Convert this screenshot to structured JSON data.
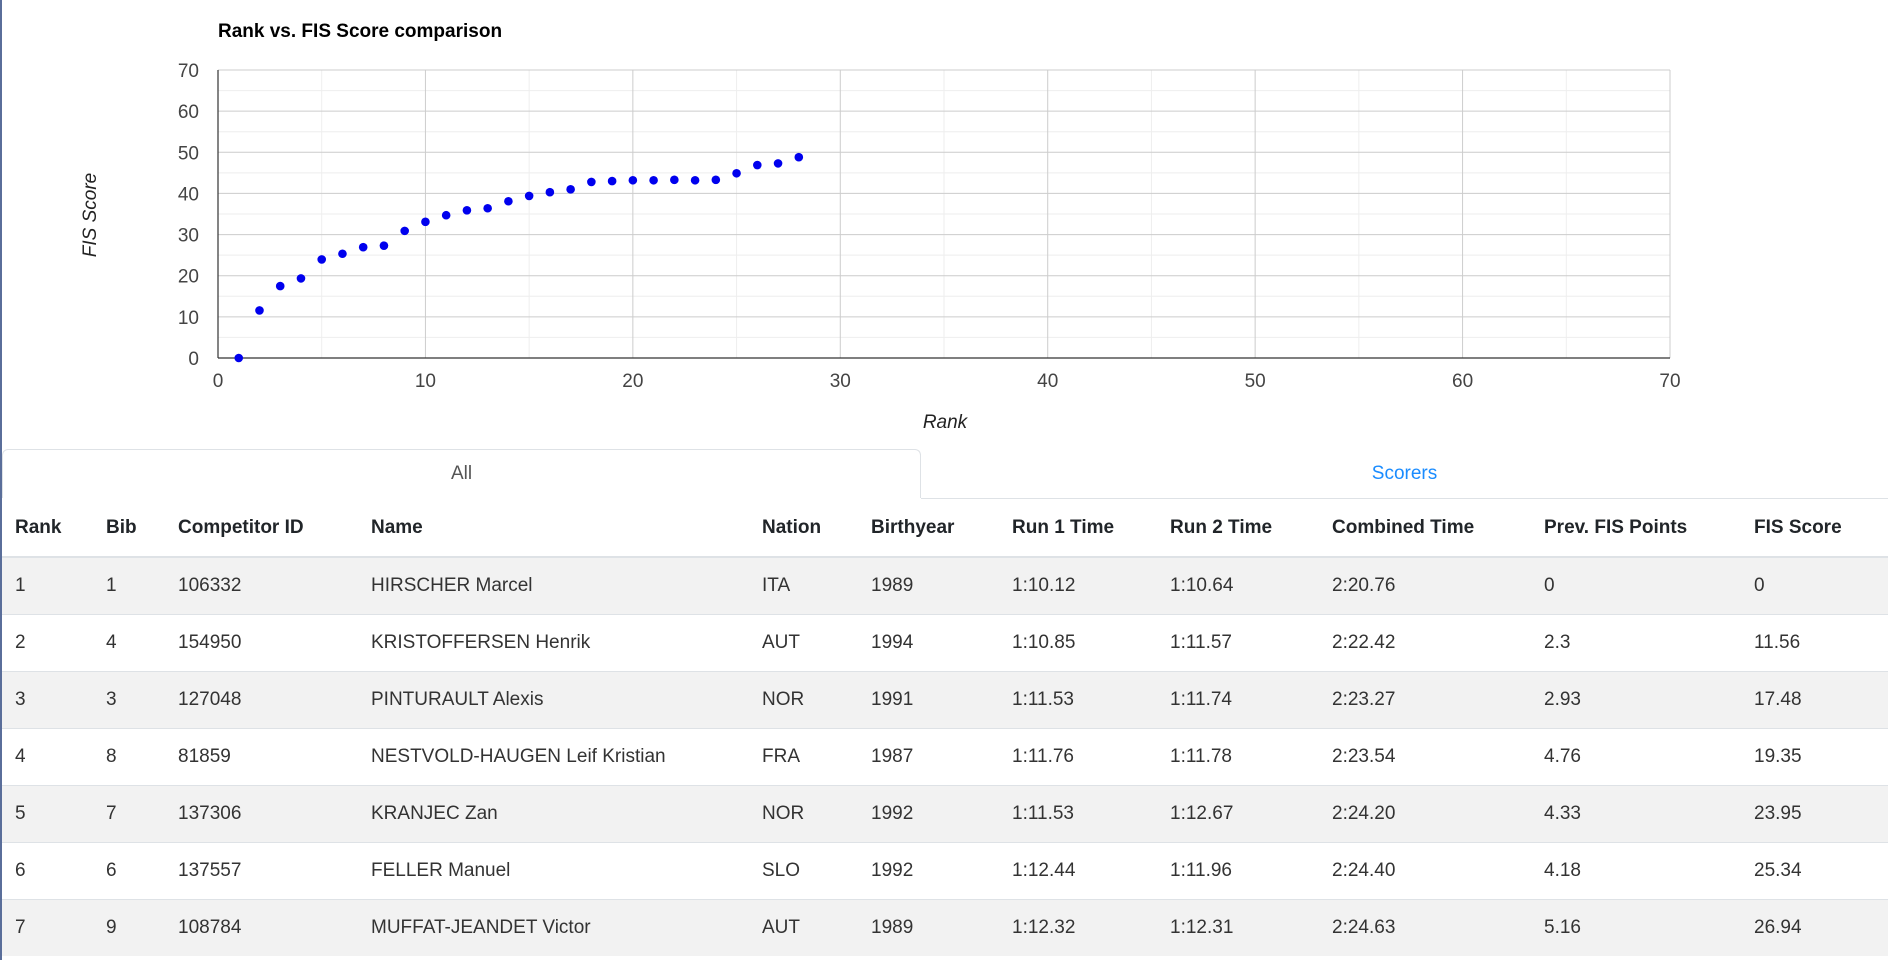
{
  "chart_data": {
    "type": "scatter",
    "title": "Rank vs. FIS Score comparison",
    "xlabel": "Rank",
    "ylabel": "FIS Score",
    "xlim": [
      0,
      70
    ],
    "ylim": [
      0,
      70
    ],
    "xticks": [
      "0",
      "10",
      "20",
      "30",
      "40",
      "50",
      "60",
      "70"
    ],
    "yticks": [
      "0",
      "10",
      "20",
      "30",
      "40",
      "50",
      "60",
      "70"
    ],
    "grid": true,
    "marker_color": "#0000ee",
    "points": [
      [
        1,
        0
      ],
      [
        2,
        11.56
      ],
      [
        3,
        17.48
      ],
      [
        4,
        19.35
      ],
      [
        5,
        23.95
      ],
      [
        6,
        25.34
      ],
      [
        7,
        26.94
      ],
      [
        8,
        27.3
      ],
      [
        9,
        30.9
      ],
      [
        10,
        33.1
      ],
      [
        11,
        34.7
      ],
      [
        12,
        35.9
      ],
      [
        13,
        36.4
      ],
      [
        14,
        38.1
      ],
      [
        15,
        39.4
      ],
      [
        16,
        40.3
      ],
      [
        17,
        41.0
      ],
      [
        18,
        42.8
      ],
      [
        19,
        43.0
      ],
      [
        20,
        43.2
      ],
      [
        21,
        43.2
      ],
      [
        22,
        43.3
      ],
      [
        23,
        43.2
      ],
      [
        24,
        43.3
      ],
      [
        25,
        44.9
      ],
      [
        26,
        46.9
      ],
      [
        27,
        47.3
      ],
      [
        28,
        48.8
      ]
    ]
  },
  "tabs": {
    "all": "All",
    "scorers": "Scorers"
  },
  "table": {
    "headers": [
      "Rank",
      "Bib",
      "Competitor ID",
      "Name",
      "Nation",
      "Birthyear",
      "Run 1 Time",
      "Run 2 Time",
      "Combined Time",
      "Prev. FIS Points",
      "FIS Score"
    ],
    "rows": [
      [
        "1",
        "1",
        "106332",
        "HIRSCHER Marcel",
        "ITA",
        "1989",
        "1:10.12",
        "1:10.64",
        "2:20.76",
        "0",
        "0"
      ],
      [
        "2",
        "4",
        "154950",
        "KRISTOFFERSEN Henrik",
        "AUT",
        "1994",
        "1:10.85",
        "1:11.57",
        "2:22.42",
        "2.3",
        "11.56"
      ],
      [
        "3",
        "3",
        "127048",
        "PINTURAULT Alexis",
        "NOR",
        "1991",
        "1:11.53",
        "1:11.74",
        "2:23.27",
        "2.93",
        "17.48"
      ],
      [
        "4",
        "8",
        "81859",
        "NESTVOLD-HAUGEN Leif Kristian",
        "FRA",
        "1987",
        "1:11.76",
        "1:11.78",
        "2:23.54",
        "4.76",
        "19.35"
      ],
      [
        "5",
        "7",
        "137306",
        "KRANJEC Zan",
        "NOR",
        "1992",
        "1:11.53",
        "1:12.67",
        "2:24.20",
        "4.33",
        "23.95"
      ],
      [
        "6",
        "6",
        "137557",
        "FELLER Manuel",
        "SLO",
        "1992",
        "1:12.44",
        "1:11.96",
        "2:24.40",
        "4.18",
        "25.34"
      ],
      [
        "7",
        "9",
        "108784",
        "MUFFAT-JEANDET Victor",
        "AUT",
        "1989",
        "1:12.32",
        "1:12.31",
        "2:24.63",
        "5.16",
        "26.94"
      ]
    ]
  }
}
